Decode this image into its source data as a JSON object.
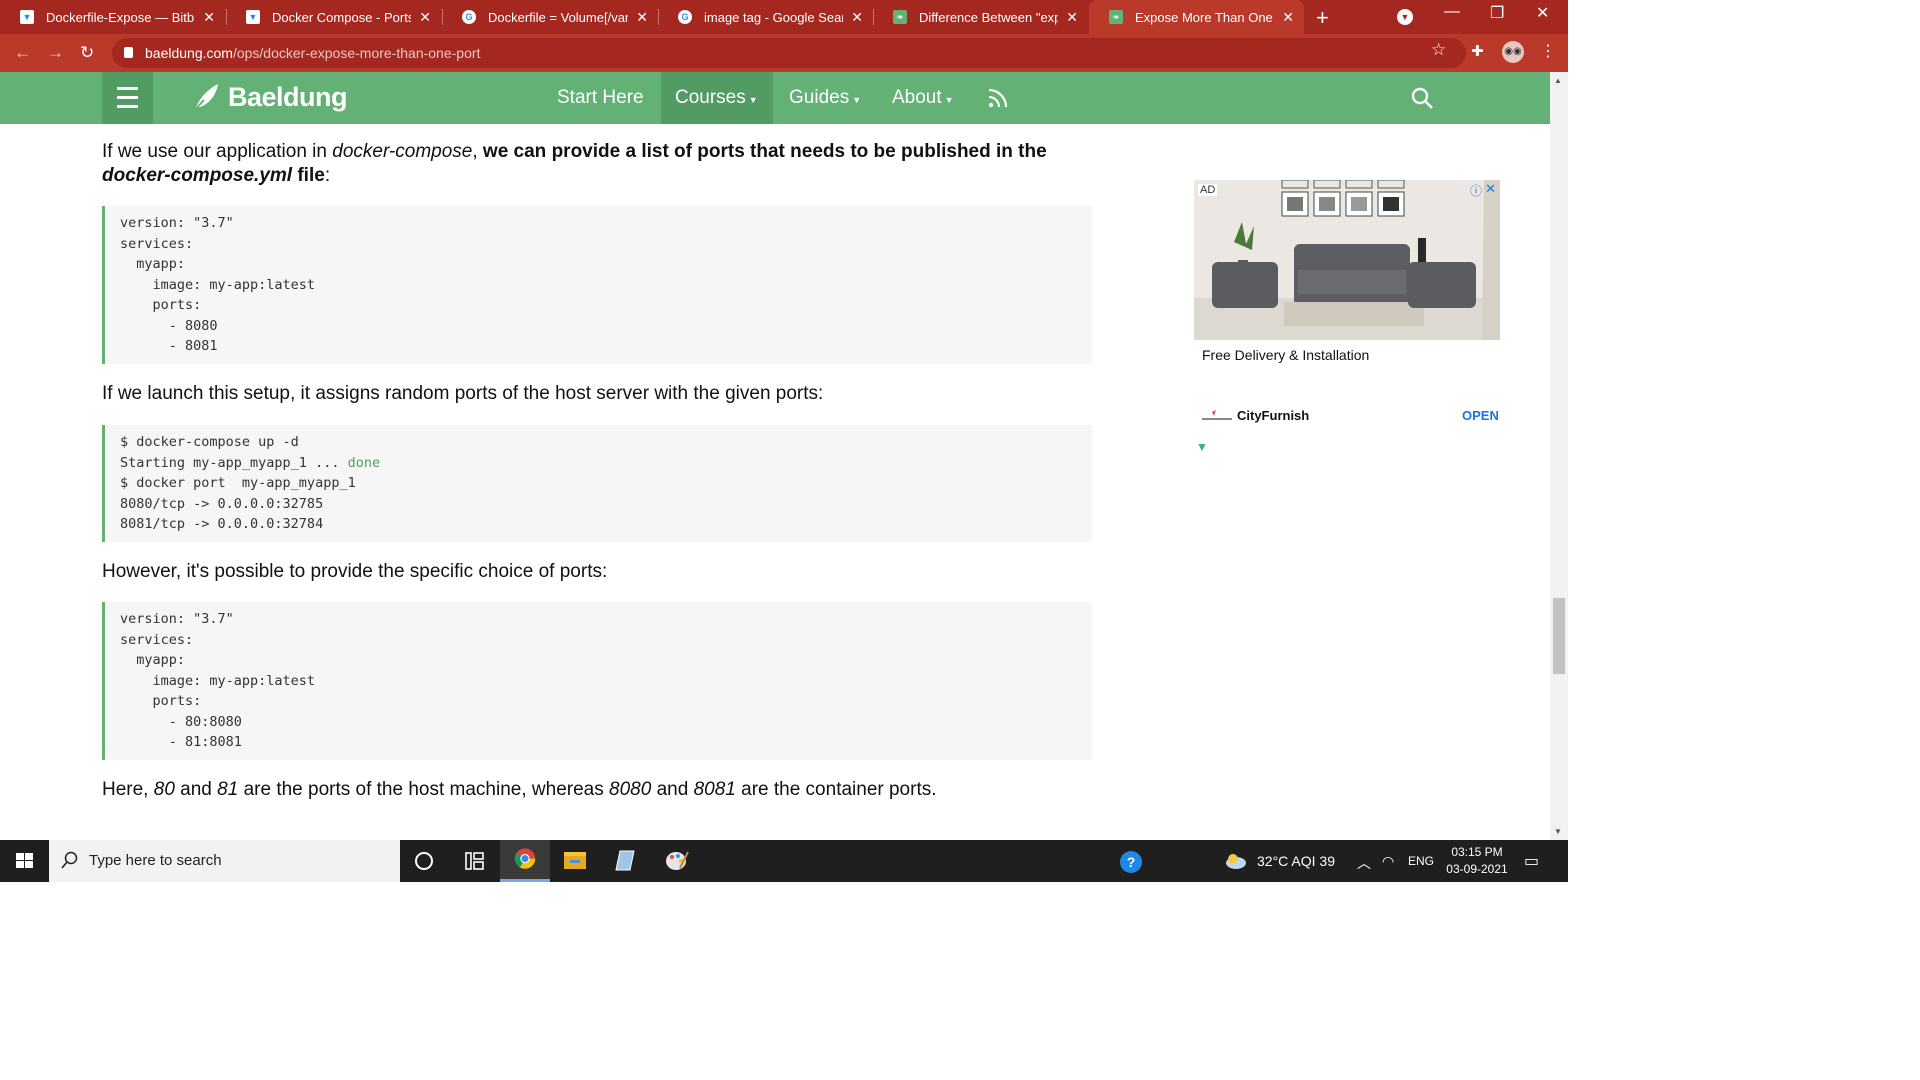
{
  "browser": {
    "tabs": [
      {
        "title": "Dockerfile-Expose — Bitbuc",
        "favicon": "bitbucket-icon"
      },
      {
        "title": "Docker Compose - Ports —",
        "favicon": "bitbucket-icon"
      },
      {
        "title": "Dockerfile = Volume[/var/lib",
        "favicon": "google-icon"
      },
      {
        "title": "image tag - Google Search",
        "favicon": "google-icon"
      },
      {
        "title": "Difference Between \"expose",
        "favicon": "baeldung-icon"
      },
      {
        "title": "Expose More Than One Por",
        "favicon": "baeldung-icon",
        "active": true
      }
    ],
    "url_domain": "baeldung.com",
    "url_path": "/ops/docker-expose-more-than-one-port",
    "theme_color": "#b93a2a"
  },
  "site": {
    "logo": "Baeldung",
    "nav": [
      {
        "label": "Start Here"
      },
      {
        "label": "Courses"
      },
      {
        "label": "Guides"
      },
      {
        "label": "About"
      }
    ],
    "accent": "#63b175"
  },
  "article": {
    "p1_pre": "If we use our application in ",
    "p1_em": "docker-compose",
    "p1_mid": ", ",
    "p1_bold": "we can provide a list of ports that needs to be published in the ",
    "p1_bold_em": "docker-compose.yml",
    "p1_bold_end": " file",
    "p1_end": ":",
    "code1": "version: \"3.7\"\nservices:\n  myapp:\n    image: my-app:latest\n    ports:\n      - 8080\n      - 8081",
    "p2": "If we launch this setup, it assigns random ports of the host server with the given ports:",
    "code2_l1": "$ docker-compose up -d",
    "code2_l2": "Starting my-app_myapp_1 ... ",
    "code2_done": "done",
    "code2_rest": "$ docker port  my-app_myapp_1\n8080/tcp -> 0.0.0.0:32785\n8081/tcp -> 0.0.0.0:32784",
    "p3": "However, it's possible to provide the specific choice of ports:",
    "code3": "version: \"3.7\"\nservices:\n  myapp:\n    image: my-app:latest\n    ports:\n      - 80:8080\n      - 81:8081",
    "p4_a": "Here, ",
    "p4_b": "80",
    "p4_c": " and ",
    "p4_d": "81",
    "p4_e": " are the ports of the host machine, whereas ",
    "p4_f": "8080",
    "p4_g": " and ",
    "p4_h": "8081",
    "p4_i": " are the container ports."
  },
  "ad": {
    "label": "AD",
    "caption": "Free Delivery & Installation",
    "brand": "CityFurnish",
    "cta": "OPEN"
  },
  "taskbar": {
    "search_placeholder": "Type here to search",
    "weather": "32°C  AQI 39",
    "language": "ENG",
    "time": "03:15 PM",
    "date": "03-09-2021"
  }
}
